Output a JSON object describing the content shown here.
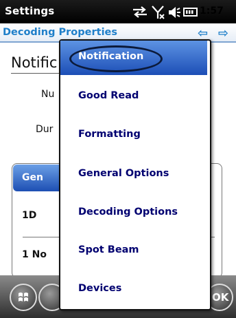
{
  "status_bar": {
    "title": "Settings",
    "time": "1:57",
    "icons": [
      "sync-arrows-icon",
      "signal-off-icon",
      "speaker-icon",
      "battery-icon"
    ]
  },
  "header": {
    "title": "Decoding Properties",
    "icons": [
      "arrow-left-icon",
      "arrow-right-icon"
    ],
    "arrow_left": "⇦",
    "arrow_right": "⇨"
  },
  "background_page": {
    "section_title": "Notific",
    "field1_label": "Nu",
    "field2_label": "Dur",
    "tab_label": "Gen",
    "item1_label": "1D",
    "item2_label": "1 No"
  },
  "menu": {
    "items": [
      {
        "label": "Notification",
        "selected": true
      },
      {
        "label": "Good Read",
        "selected": false
      },
      {
        "label": "Formatting",
        "selected": false
      },
      {
        "label": "General Options",
        "selected": false
      },
      {
        "label": "Decoding Options",
        "selected": false
      },
      {
        "label": "Spot Beam",
        "selected": false
      },
      {
        "label": "Devices",
        "selected": false
      }
    ]
  },
  "taskbar": {
    "ok_label": "OK",
    "icons": [
      "windows-start-icon",
      "ok-icon"
    ]
  },
  "colors": {
    "accent": "#1f7fc9",
    "menu_highlight": "#2a5fc4",
    "menu_text": "#000070"
  }
}
